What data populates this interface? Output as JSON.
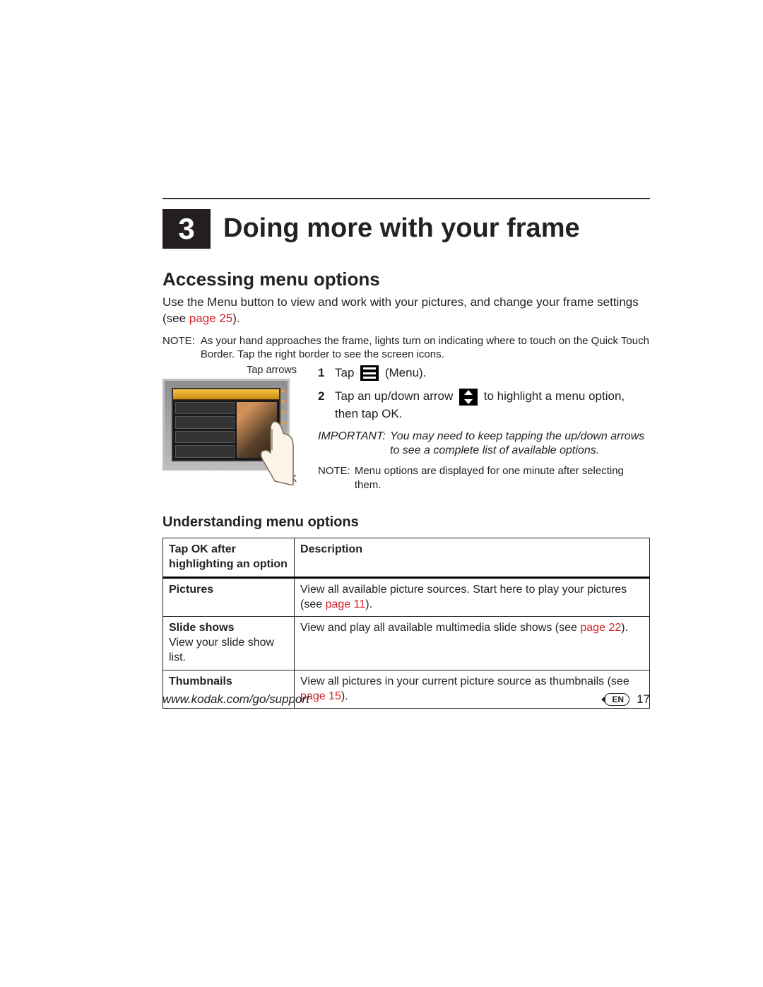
{
  "chapter": {
    "number": "3",
    "title": "Doing more with your frame"
  },
  "section1": {
    "heading": "Accessing menu options",
    "intro_a": "Use the Menu button to view and work with your pictures, and change your frame settings (see ",
    "intro_link": "page 25",
    "intro_b": ").",
    "note_label": "NOTE:",
    "note_body": "As your hand approaches the frame, lights turn on indicating where to touch on the Quick Touch Border. Tap the right border to see the screen icons."
  },
  "figure": {
    "tap_arrows": "Tap arrows",
    "ok_label": "OK"
  },
  "steps": {
    "s1": {
      "num": "1",
      "a": "Tap ",
      "b": " (Menu)."
    },
    "s2": {
      "num": "2",
      "a": "Tap an up/down arrow ",
      "b": " to highlight a menu option, then tap OK."
    },
    "important_label": "IMPORTANT:",
    "important_text": "You may need to keep tapping the up/down arrows to see a complete list of available options.",
    "note2_label": "NOTE:",
    "note2_body": "Menu options are displayed for one minute after selecting them."
  },
  "section2": {
    "heading": "Understanding menu options",
    "th1": "Tap OK after highlighting an option",
    "th2": "Description",
    "rows": [
      {
        "c1_title": "Pictures",
        "c1_sub": "",
        "c2_a": "View all available picture sources. Start here to play your pictures (see ",
        "c2_link": "page 11",
        "c2_b": ")."
      },
      {
        "c1_title": "Slide shows",
        "c1_sub": "View your slide show list.",
        "c2_a": "View and play all available multimedia slide shows (see ",
        "c2_link": "page 22",
        "c2_b": ")."
      },
      {
        "c1_title": "Thumbnails",
        "c1_sub": "",
        "c2_a": "View all pictures in your current picture source as thumbnails (see ",
        "c2_link": "page 15",
        "c2_b": ")."
      }
    ]
  },
  "footer": {
    "url": "www.kodak.com/go/support",
    "lang": "EN",
    "page": "17"
  }
}
